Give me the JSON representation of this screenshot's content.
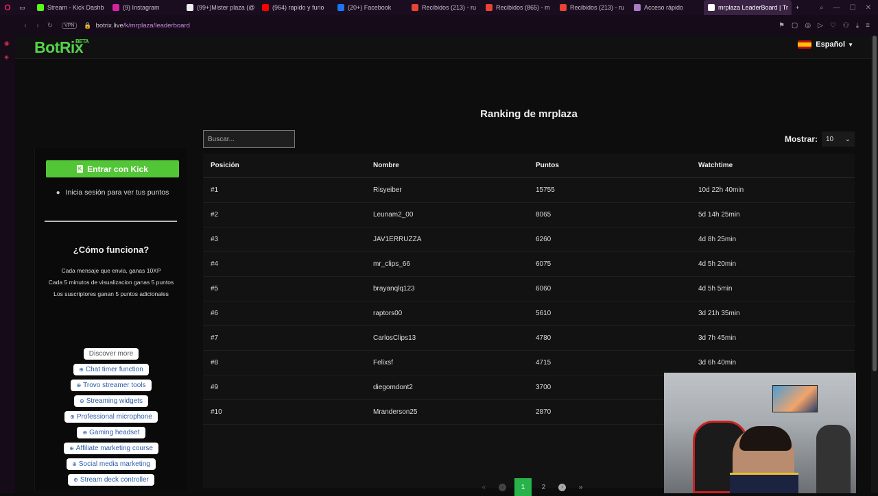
{
  "browser": {
    "tabs": [
      {
        "label": "Stream - Kick Dashb",
        "color": "#53fc18"
      },
      {
        "label": "(9) Instagram",
        "color": "#d6249f"
      },
      {
        "label": "(99+)Mister plaza (@",
        "color": "#eeeeee"
      },
      {
        "label": "(964) rapido y furio",
        "color": "#ff0000"
      },
      {
        "label": "(20+) Facebook",
        "color": "#1877f2"
      },
      {
        "label": "Recibidos (213) - ru",
        "color": "#ea4335"
      },
      {
        "label": "Recibidos (865) - m",
        "color": "#ea4335"
      },
      {
        "label": "Recibidos (213) - ru",
        "color": "#ea4335"
      },
      {
        "label": "Acceso rápido",
        "color": "#a87bc6"
      },
      {
        "label": "mrplaza LeaderBoard | Tr",
        "color": "#ffffff",
        "active": true
      }
    ],
    "vpn_label": "VPN",
    "url_host": "botrix.live",
    "url_path": "/k/mrplaza/leaderboard"
  },
  "header": {
    "logo": "BotRix",
    "beta": "BETA",
    "language": "Español"
  },
  "sidebar": {
    "kick_button": "Entrar con Kick",
    "kick_icon_letter": "K",
    "login_hint": "Inicia sesión para ver tus puntos",
    "how_title": "¿Cómo funciona?",
    "how_lines": [
      "Cada mensaje que envia, ganas 10XP",
      "Cada 5 minutos de visualizacion ganas 5 puntos",
      "Los suscriptores ganan 5 puntos adicionales"
    ],
    "discover_more": "Discover more",
    "links": [
      "Chat timer function",
      "Trovo streamer tools",
      "Streaming widgets",
      "Professional microphone",
      "Gaming headset",
      "Affiliate marketing course",
      "Social media marketing",
      "Stream deck controller"
    ]
  },
  "main": {
    "title": "Ranking de mrplaza",
    "search_placeholder": "Buscar...",
    "show_label": "Mostrar:",
    "show_value": "10",
    "columns": [
      "Posición",
      "Nombre",
      "Puntos",
      "Watchtime"
    ],
    "rows": [
      {
        "pos": "#1",
        "name": "Risyeiber",
        "points": "15755",
        "watch": "10d 22h 40min"
      },
      {
        "pos": "#2",
        "name": "Leunam2_00",
        "points": "8065",
        "watch": "5d 14h 25min"
      },
      {
        "pos": "#3",
        "name": "JAV1ERRUZZA",
        "points": "6260",
        "watch": "4d 8h 25min"
      },
      {
        "pos": "#4",
        "name": "mr_clips_66",
        "points": "6075",
        "watch": "4d 5h 20min"
      },
      {
        "pos": "#5",
        "name": "brayanqlq123",
        "points": "6060",
        "watch": "4d 5h 5min"
      },
      {
        "pos": "#6",
        "name": "raptors00",
        "points": "5610",
        "watch": "3d 21h 35min"
      },
      {
        "pos": "#7",
        "name": "CarlosClips13",
        "points": "4780",
        "watch": "3d 7h 45min"
      },
      {
        "pos": "#8",
        "name": "Felixsf",
        "points": "4715",
        "watch": "3d 6h 40min"
      },
      {
        "pos": "#9",
        "name": "diegomdont2",
        "points": "3700",
        "watch": ""
      },
      {
        "pos": "#10",
        "name": "Mranderson25",
        "points": "2870",
        "watch": ""
      }
    ],
    "pagination": {
      "first": "«",
      "prev": "‹",
      "pages": [
        "1",
        "2"
      ],
      "current": "1",
      "next": "›",
      "last": "»"
    }
  },
  "colors": {
    "brand_green": "#53c637",
    "logo_green": "#56d34a",
    "active_page": "#27b24a"
  }
}
